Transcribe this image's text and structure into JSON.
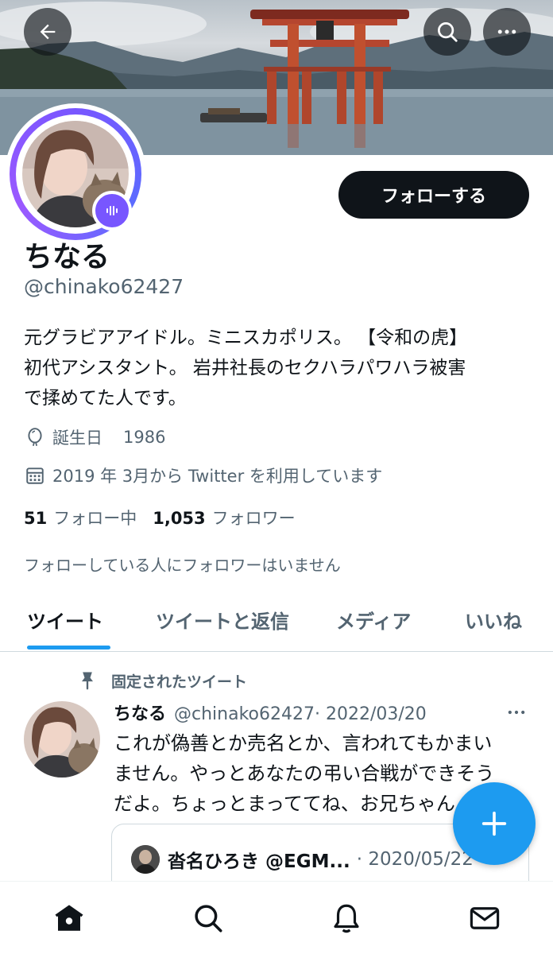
{
  "header": {
    "back_icon": "arrow-left-icon",
    "search_icon": "search-icon",
    "more_icon": "more-horizontal-icon"
  },
  "profile": {
    "display_name": "ちなる",
    "handle": "@chinako62427",
    "follow_button": "フォローする",
    "bio_lines": [
      "元グラビアアイドル。ミニスカポリス。 【令和の虎】",
      "初代アシスタント。 岩井社長のセクハラパワハラ被害",
      "で揉めてた人です。"
    ],
    "birth_label": "誕生日",
    "birth_value": "1986",
    "joined": "2019 年 3月から Twitter を利用しています",
    "following_count": "51",
    "following_label": "フォロー中",
    "followers_count": "1,053",
    "followers_label": "フォロワー",
    "mutual_notice": "フォローしている人にフォロワーはいません",
    "accent_color": "#1d9bf0",
    "spaces_color": "#7856ff"
  },
  "tabs": [
    {
      "label": "ツイート",
      "active": true
    },
    {
      "label": "ツイートと返信",
      "active": false
    },
    {
      "label": "メディア",
      "active": false
    },
    {
      "label": "いいね",
      "active": false
    }
  ],
  "pinned_tweet": {
    "pinned_label": "固定されたツイート",
    "author_name": "ちなる",
    "author_handle": "@chinako62427",
    "date": "· 2022/03/20",
    "text_lines": [
      "これが偽善とか売名とか、言われてもかまい",
      "ません。やっとあなたの弔い合戦ができそう",
      "だよ。ちょっとまっててね、お兄ちゃん"
    ],
    "quote": {
      "author": "沓名ひろき @EGM...",
      "date": "· 2020/05/22"
    }
  },
  "fab_icon": "compose-plus-icon",
  "bottom_nav": [
    {
      "name": "home",
      "icon": "home-icon"
    },
    {
      "name": "search",
      "icon": "search-icon"
    },
    {
      "name": "notifications",
      "icon": "bell-icon"
    },
    {
      "name": "messages",
      "icon": "mail-icon"
    }
  ]
}
